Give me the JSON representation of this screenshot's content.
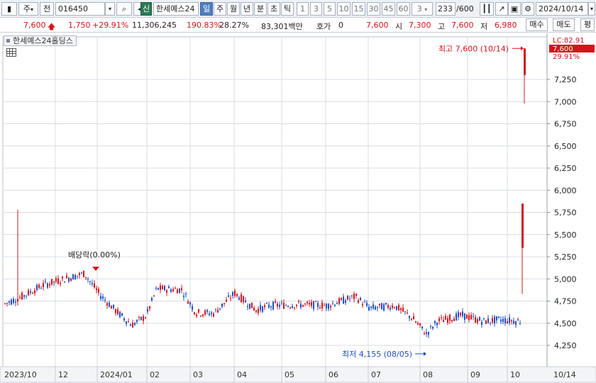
{
  "toolbar": {
    "market_label": "주",
    "price_type_label": "전",
    "code": "016450",
    "tag_label": "신",
    "stock_name": "한세예스24",
    "period_tabs": [
      "일",
      "주",
      "월",
      "년",
      "분",
      "초",
      "틱"
    ],
    "interval_numbers": [
      "1",
      "3",
      "5",
      "10",
      "15",
      "30",
      "45",
      "60"
    ],
    "interval_select": "3",
    "count": "233",
    "count_max": "/600",
    "date": "2024/10/14"
  },
  "quote": {
    "price": "7,600",
    "change": "1,750",
    "change_pct": "+29.91%",
    "volume": "11,306,245",
    "volume_ratio": "190.83%",
    "turnover": "28.27%",
    "amount": "83,301백만",
    "hoga_label": "호가",
    "hoga_value": "0",
    "hoga_price": "7,600",
    "open_label": "시",
    "open": "7,300",
    "high_label": "고",
    "high": "7,600",
    "low_label": "저",
    "low": "6,980",
    "buy_label": "매수",
    "sell_label": "매도",
    "avg_label": "평"
  },
  "chart_title": "한세예스24홀딩스",
  "colors": {
    "up": "#d2141b",
    "down": "#1f4fc6",
    "grid": "#d8dce4",
    "accent": "#4f7fbf"
  },
  "chart_data": {
    "type": "candlestick",
    "y_axis_ticks": [
      "7,250",
      "7,000",
      "6,750",
      "6,500",
      "6,250",
      "6,000",
      "5,750",
      "5,500",
      "5,250",
      "5,000",
      "4,750",
      "4,500",
      "4,250"
    ],
    "ylim": [
      4050,
      7700
    ],
    "x_axis_labels": [
      "2023/10",
      "12",
      "2024/01",
      "02",
      "03",
      "04",
      "05",
      "06",
      "07",
      "08",
      "09",
      "10",
      "10/14"
    ],
    "right_labels": {
      "lc": "LC:82.91",
      "last_price": "7,600",
      "last_pct": "29.91%"
    },
    "annotations": {
      "high": "최고 7,600 (10/14)",
      "low": "최저 4,155 (08/05)",
      "dividend": "배당락(0.00%)"
    },
    "key_bars": [
      {
        "date": "2024/10/11",
        "open": 5350,
        "high": 5850,
        "low": 4830,
        "close": 5850
      },
      {
        "date": "2024/10/14",
        "open": 7300,
        "high": 7600,
        "low": 6980,
        "close": 7600
      }
    ]
  }
}
